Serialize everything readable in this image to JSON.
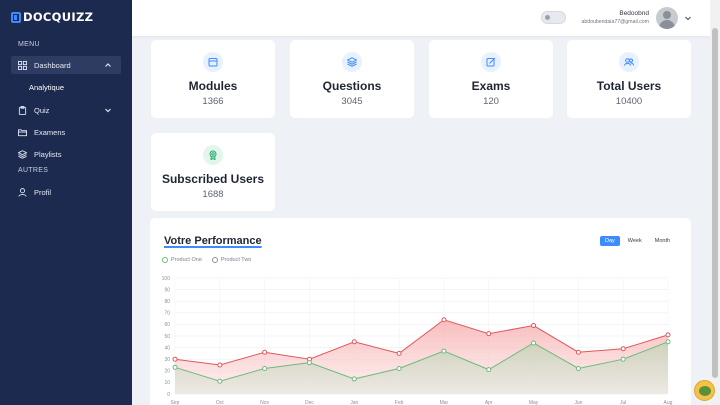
{
  "brand": {
    "name": "DOCQUIZZ"
  },
  "sidebar": {
    "menu_label": "MENU",
    "other_label": "AUTRES",
    "items": [
      {
        "label": "Dashboard",
        "icon": "grid-icon"
      },
      {
        "label": "Analytique"
      },
      {
        "label": "Quiz",
        "icon": "clipboard-icon"
      },
      {
        "label": "Examens",
        "icon": "folder-icon"
      },
      {
        "label": "Playlists",
        "icon": "layers-icon"
      },
      {
        "label": "Profil",
        "icon": "user-icon"
      }
    ]
  },
  "header": {
    "user_name": "Bedoobnd",
    "user_email": "abdoubendaia77@gmail.com"
  },
  "stats": [
    {
      "title": "Modules",
      "value": "1366",
      "icon": "calendar-icon",
      "color": "#3d8bff"
    },
    {
      "title": "Questions",
      "value": "3045",
      "icon": "layers-icon",
      "color": "#3d8bff"
    },
    {
      "title": "Exams",
      "value": "120",
      "icon": "edit-icon",
      "color": "#3d8bff"
    },
    {
      "title": "Total Users",
      "value": "10400",
      "icon": "users-icon",
      "color": "#3d8bff"
    },
    {
      "title": "Subscribed Users",
      "value": "1688",
      "icon": "award-icon",
      "color": "#1faa6a"
    }
  ],
  "performance": {
    "title": "Votre Performance",
    "ranges": [
      "Day",
      "Week",
      "Month"
    ],
    "active_range": "Day"
  },
  "chart_data": {
    "type": "area",
    "categories": [
      "Sep",
      "Oct",
      "Nov",
      "Dec",
      "Jan",
      "Feb",
      "Mar",
      "Apr",
      "May",
      "Jun",
      "Jul",
      "Aug"
    ],
    "series": [
      {
        "name": "Product One",
        "color": "#e0585b",
        "values": [
          30,
          25,
          36,
          30,
          45,
          35,
          64,
          52,
          59,
          36,
          39,
          51
        ]
      },
      {
        "name": "Product Two",
        "color": "#6dba7e",
        "values": [
          23,
          11,
          22,
          27,
          13,
          22,
          37,
          21,
          44,
          22,
          30,
          45
        ]
      }
    ],
    "yticks": [
      "0",
      "10",
      "20",
      "30",
      "40",
      "50",
      "60",
      "70",
      "80",
      "90",
      "100"
    ],
    "ylim": [
      0,
      100
    ],
    "grid": true,
    "legend": "top-left"
  }
}
